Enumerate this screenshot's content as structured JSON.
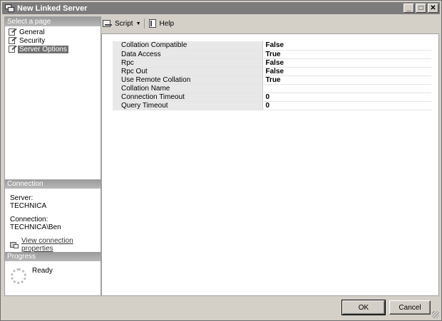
{
  "window": {
    "title": "New Linked Server",
    "controls": [
      "_",
      "□",
      "✕"
    ]
  },
  "sidebar": {
    "select_page_header": "Select a page",
    "pages": [
      {
        "label": "General",
        "selected": false
      },
      {
        "label": "Security",
        "selected": false
      },
      {
        "label": "Server Options",
        "selected": true
      }
    ],
    "connection": {
      "header": "Connection",
      "server_label": "Server:",
      "server_value": "TECHNICA",
      "connection_label": "Connection:",
      "connection_value": "TECHNICA\\Ben",
      "link_label": "View connection properties"
    },
    "progress": {
      "header": "Progress",
      "status": "Ready"
    }
  },
  "toolbar": {
    "script_label": "Script",
    "help_label": "Help"
  },
  "properties": [
    {
      "name": "Collation Compatible",
      "value": "False"
    },
    {
      "name": "Data Access",
      "value": "True"
    },
    {
      "name": "Rpc",
      "value": "False"
    },
    {
      "name": "Rpc Out",
      "value": "False"
    },
    {
      "name": "Use Remote Collation",
      "value": "True"
    },
    {
      "name": "Collation Name",
      "value": ""
    },
    {
      "name": "Connection Timeout",
      "value": "0"
    },
    {
      "name": "Query Timeout",
      "value": "0"
    }
  ],
  "buttons": {
    "ok": "OK",
    "cancel": "Cancel"
  }
}
